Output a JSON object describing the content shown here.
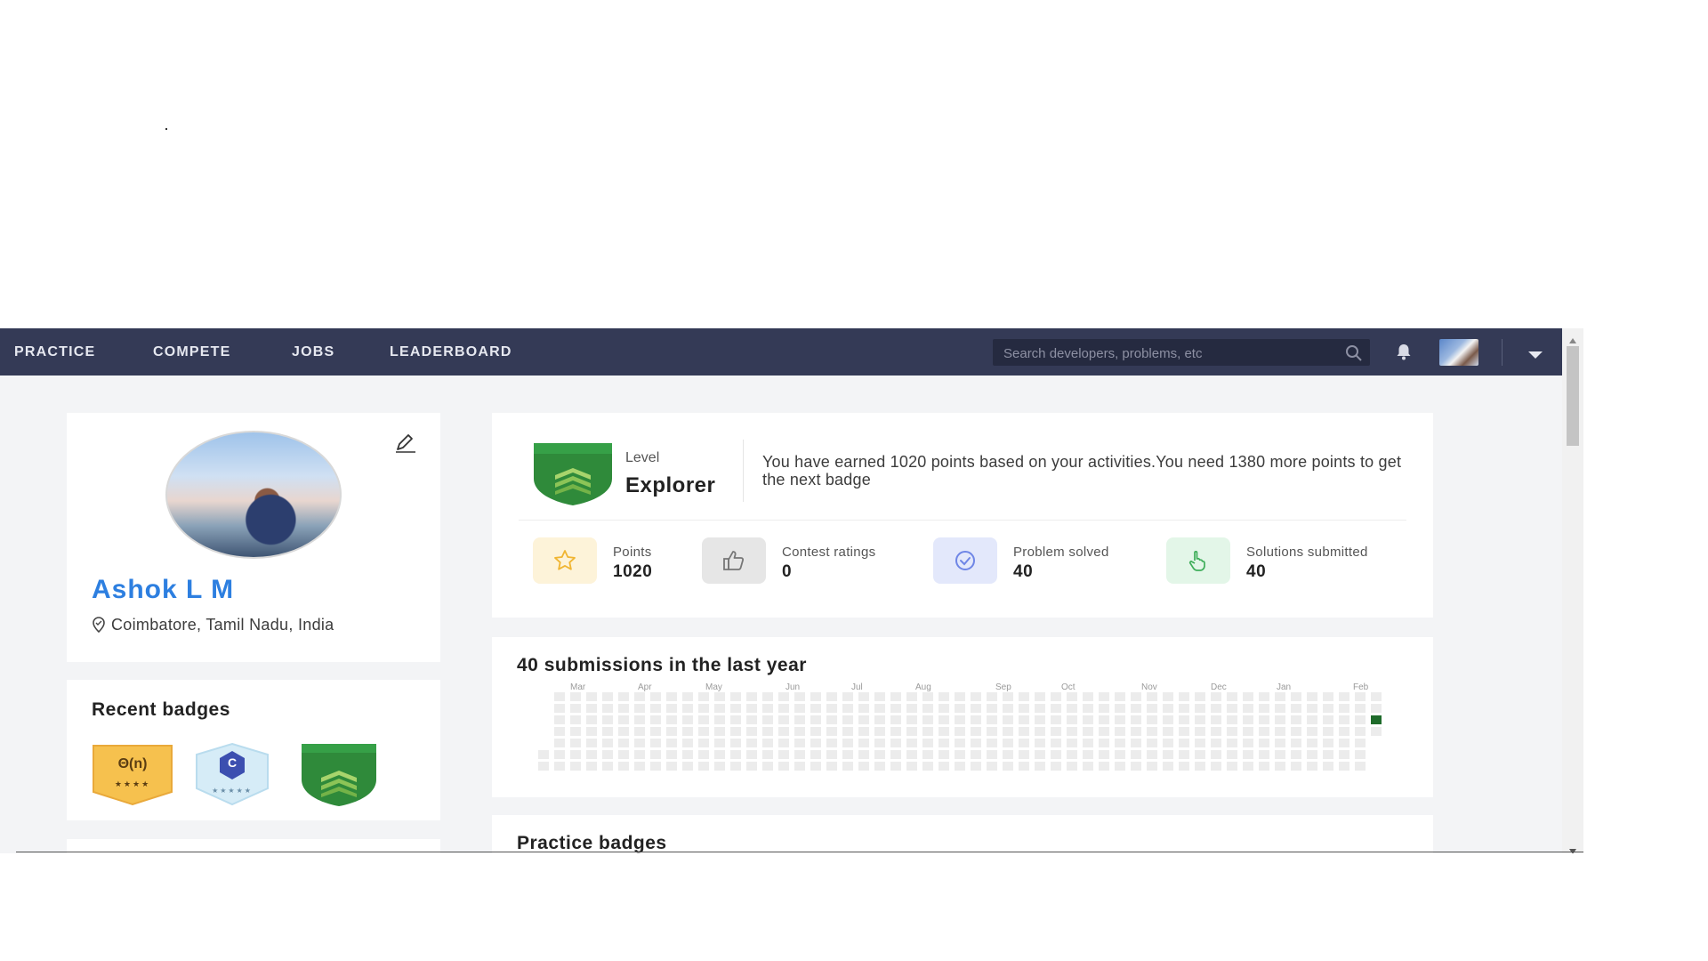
{
  "nav": {
    "items": [
      {
        "label": "PRACTICE"
      },
      {
        "label": "COMPETE"
      },
      {
        "label": "JOBS"
      },
      {
        "label": "LEADERBOARD"
      }
    ],
    "search_placeholder": "Search developers, problems, etc",
    "icons": [
      "search-icon",
      "bell-icon",
      "avatar",
      "chevron-down-icon"
    ],
    "colors": {
      "nav_bg": "#343a56",
      "accent": "#2d7fe0"
    }
  },
  "profile": {
    "name": "Ashok L M",
    "location": "Coimbatore, Tamil Nadu, India"
  },
  "recent_badges": {
    "title": "Recent badges",
    "items": [
      {
        "text": "Θ(n)",
        "stars": "★★★★",
        "color": "#f6c14e"
      },
      {
        "text": "C",
        "stars": "★★★★★",
        "color": "#d6ecf7"
      },
      {
        "text": "",
        "stars": "",
        "color": "#2f8a3a"
      }
    ]
  },
  "level": {
    "label": "Level",
    "name": "Explorer",
    "message": "You have earned 1020 points based on your activities.You need 1380 more points to get the next badge"
  },
  "stats": [
    {
      "label": "Points",
      "value": "1020",
      "icon": "star-icon",
      "bg": "#fdf3d9"
    },
    {
      "label": "Contest ratings",
      "value": "0",
      "icon": "thumbs-up-icon",
      "bg": "#e6e6e6"
    },
    {
      "label": "Problem solved",
      "value": "40",
      "icon": "check-circle-icon",
      "bg": "#e3e8fb"
    },
    {
      "label": "Solutions submitted",
      "value": "40",
      "icon": "hand-pointer-icon",
      "bg": "#e3f6e8"
    }
  ],
  "submissions": {
    "title": "40 submissions in the last year",
    "months": [
      "Mar",
      "Apr",
      "May",
      "Jun",
      "Jul",
      "Aug",
      "Sep",
      "Oct",
      "Nov",
      "Dec",
      "Jan",
      "Feb"
    ],
    "colors": {
      "empty": "#ececec",
      "active": "#1e6b2a"
    }
  },
  "practice_badges": {
    "title": "Practice badges"
  }
}
